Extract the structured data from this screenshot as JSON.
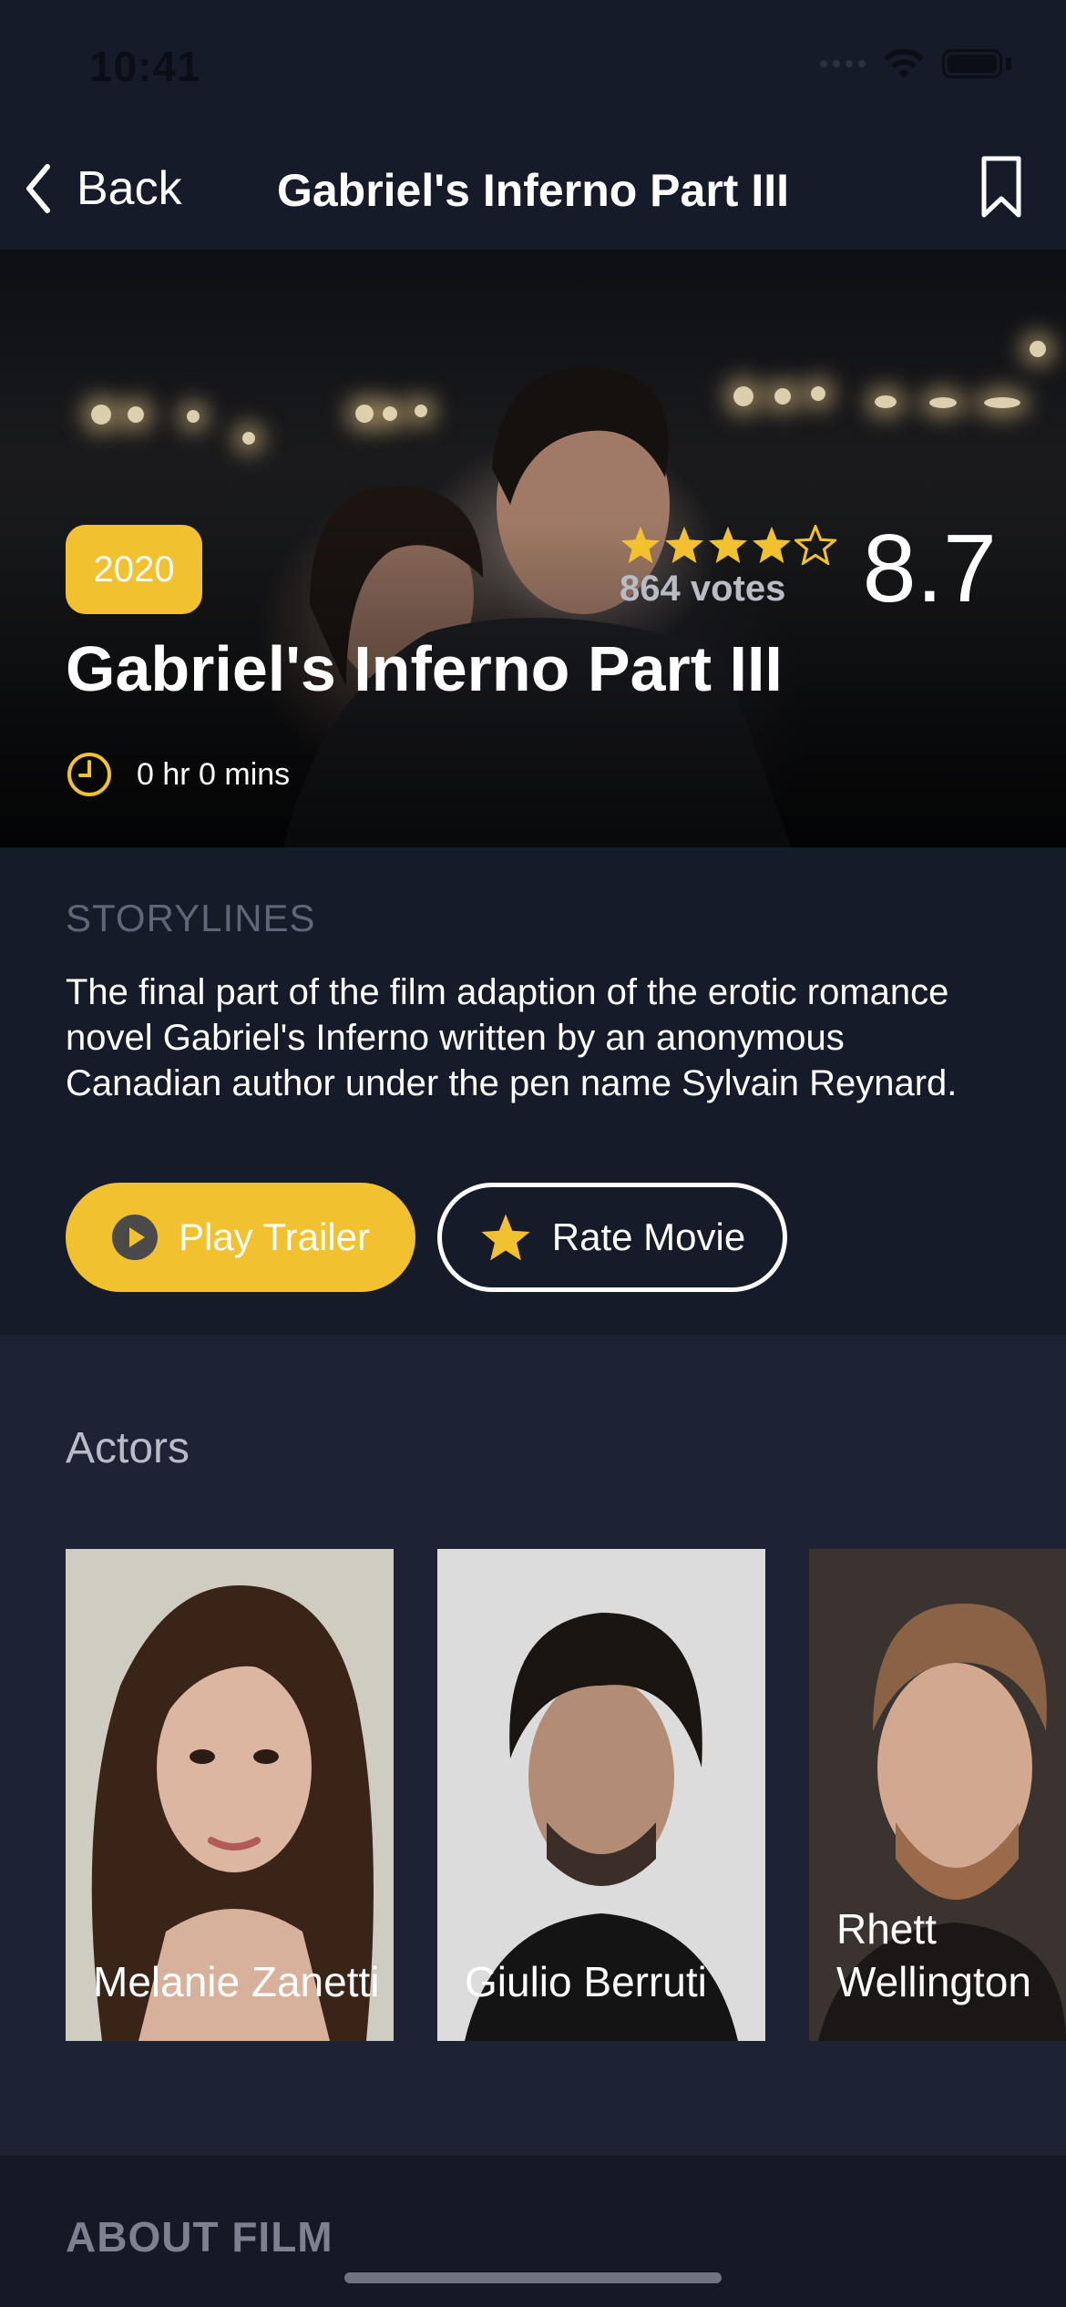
{
  "status_bar": {
    "time": "10:41"
  },
  "nav": {
    "back_label": "Back",
    "title": "Gabriel's Inferno Part III"
  },
  "hero": {
    "year": "2020",
    "rating_stars": 4.5,
    "votes": "864 votes",
    "score": "8.7",
    "title": "Gabriel's Inferno Part III",
    "runtime": "0 hr 0 mins"
  },
  "storyline": {
    "label": "STORYLINES",
    "text": "The final part of the film adaption of the erotic romance novel Gabriel's Inferno written by an anonymous Canadian author under the pen name Sylvain Reynard.",
    "play_trailer_label": "Play Trailer",
    "rate_movie_label": "Rate Movie"
  },
  "actors": {
    "title": "Actors",
    "items": [
      {
        "name": "Melanie Zanetti"
      },
      {
        "name": "Giulio Berruti"
      },
      {
        "name": "Rhett Wellington"
      }
    ]
  },
  "about": {
    "label": "ABOUT FILM"
  },
  "colors": {
    "accent": "#f1c12f",
    "background": "#151b28",
    "actors_bg": "#1d2234"
  }
}
